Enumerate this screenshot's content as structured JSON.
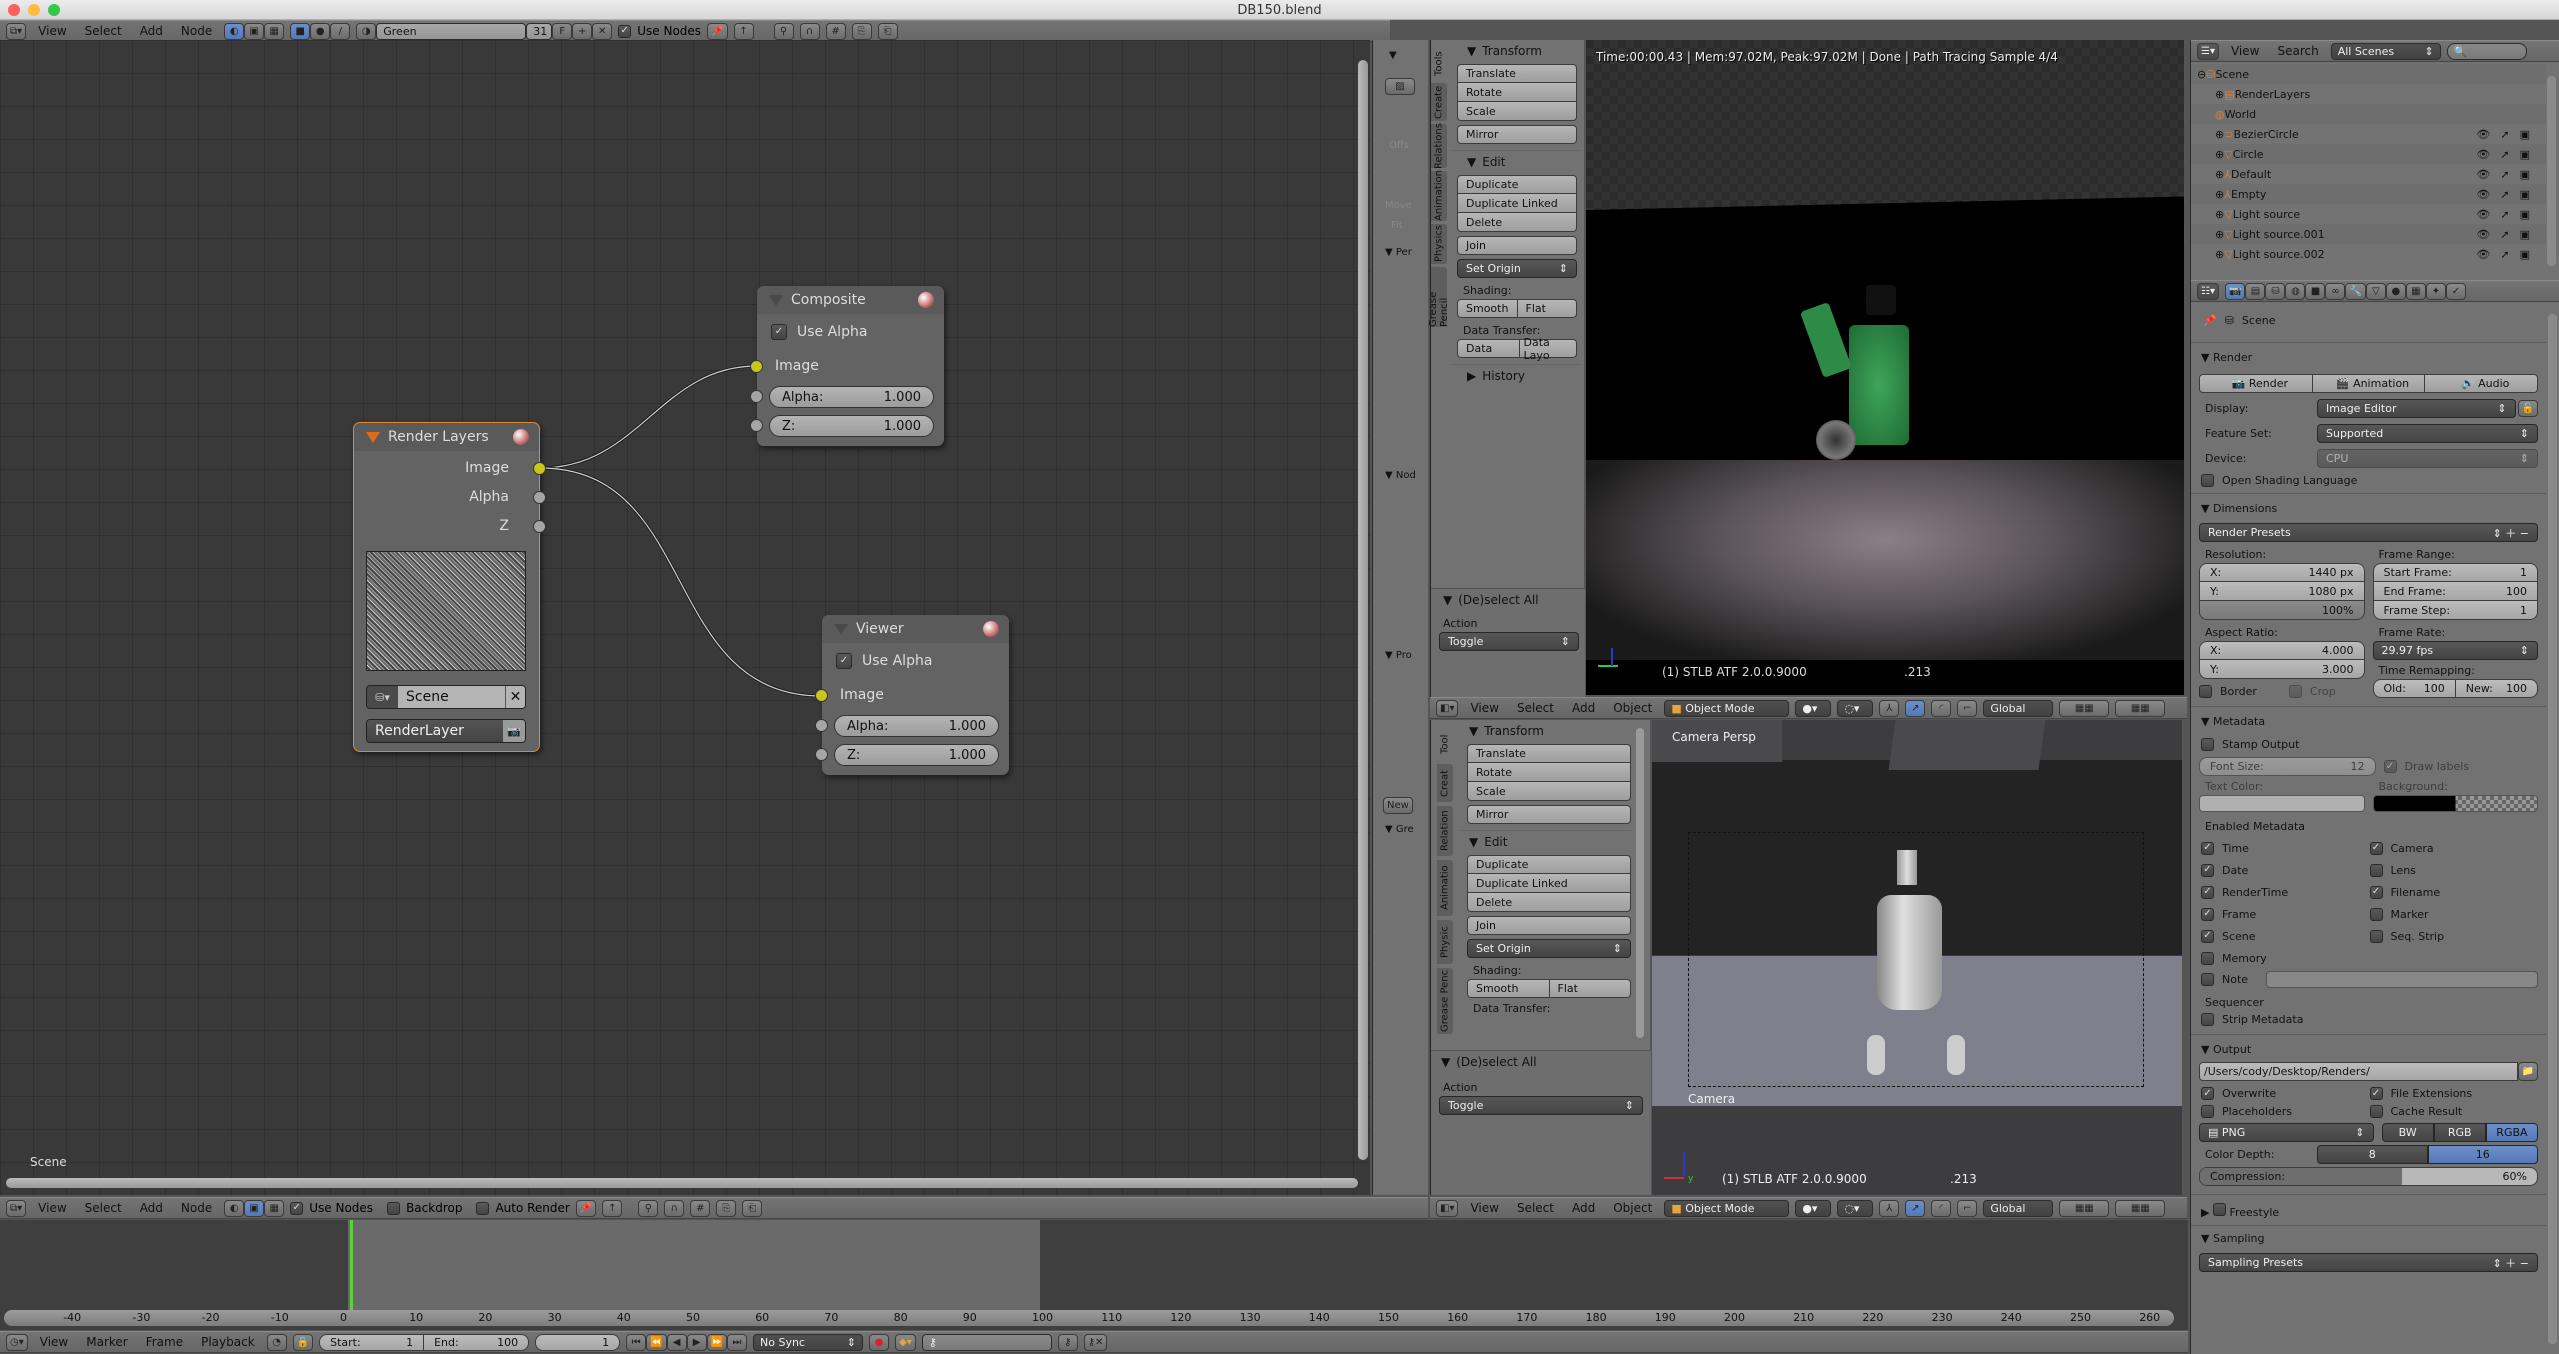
{
  "window": {
    "title": "DB150.blend"
  },
  "node_editor": {
    "header": {
      "menus": [
        "View",
        "Select",
        "Add",
        "Node"
      ],
      "material_name": "Green",
      "users": "31",
      "fake_user": "F",
      "use_nodes_label": "Use Nodes",
      "use_nodes": true
    },
    "bottom_header": {
      "menus": [
        "View",
        "Select",
        "Add",
        "Node"
      ],
      "use_nodes_label": "Use Nodes",
      "backdrop_label": "Backdrop",
      "auto_render_label": "Auto Render"
    },
    "scene_label": "Scene",
    "nodes": {
      "render_layers": {
        "title": "Render Layers",
        "outputs": [
          "Image",
          "Alpha",
          "Z"
        ],
        "scene": "Scene",
        "layer": "RenderLayer"
      },
      "composite": {
        "title": "Composite",
        "use_alpha_label": "Use Alpha",
        "use_alpha": true,
        "input_label": "Image",
        "alpha_label": "Alpha:",
        "alpha_value": "1.000",
        "z_label": "Z:",
        "z_value": "1.000"
      },
      "viewer": {
        "title": "Viewer",
        "use_alpha_label": "Use Alpha",
        "use_alpha": true,
        "input_label": "Image",
        "alpha_label": "Alpha:",
        "alpha_value": "1.000",
        "z_label": "Z:",
        "z_value": "1.000"
      }
    },
    "side_panel": {
      "offs_label": "Offs",
      "move_label": "Move",
      "fit_label": "Fit",
      "per_label": "Per",
      "nod_label": "Nod",
      "pro_label": "Pro",
      "gre_label": "Gre",
      "new_label": "New"
    }
  },
  "tool_shelf_top": {
    "tabs": [
      "Tools",
      "Create",
      "Relations",
      "Animation",
      "Physics",
      "Grease Pencil"
    ],
    "transform_title": "Transform",
    "transform_buttons": [
      "Translate",
      "Rotate",
      "Scale"
    ],
    "mirror": "Mirror",
    "edit_title": "Edit",
    "edit_buttons": [
      "Duplicate",
      "Duplicate Linked",
      "Delete"
    ],
    "join": "Join",
    "set_origin": "Set Origin",
    "shading_label": "Shading:",
    "smooth": "Smooth",
    "flat": "Flat",
    "data_transfer_label": "Data Transfer:",
    "data": "Data",
    "data_layout": "Data Layo",
    "history": "History",
    "deselect_title": "(De)select All",
    "action_label": "Action",
    "action_value": "Toggle"
  },
  "viewport_top": {
    "status": "Time:00:00.43 | Mem:97.02M, Peak:97.02M | Done | Path Tracing Sample 4/4",
    "object_info": "(1) STLB ATF 2.0.0.9000",
    "frame_info": ".213",
    "header": {
      "menus": [
        "View",
        "Select",
        "Add",
        "Object"
      ],
      "mode": "Object Mode",
      "orientation": "Global"
    }
  },
  "tool_shelf_bottom": {
    "tabs": [
      "Tool",
      "Creat",
      "Relation",
      "Animatio",
      "Physic",
      "Grease Penc"
    ],
    "transform_title": "Transform",
    "transform_buttons": [
      "Translate",
      "Rotate",
      "Scale"
    ],
    "mirror": "Mirror",
    "edit_title": "Edit",
    "edit_buttons": [
      "Duplicate",
      "Duplicate Linked",
      "Delete"
    ],
    "join": "Join",
    "set_origin": "Set Origin",
    "shading_label": "Shading:",
    "smooth": "Smooth",
    "flat": "Flat",
    "data_transfer_label": "Data Transfer:",
    "deselect_title": "(De)select All",
    "action_label": "Action",
    "action_value": "Toggle"
  },
  "viewport_bottom": {
    "view_label": "Camera Persp",
    "camera_label": "Camera",
    "object_info": "(1) STLB ATF 2.0.0.9000",
    "frame_info": ".213",
    "header": {
      "menus": [
        "View",
        "Select",
        "Add",
        "Object"
      ],
      "mode": "Object Mode",
      "orientation": "Global"
    }
  },
  "outliner": {
    "menus": [
      "View",
      "Search"
    ],
    "scene_filter": "All Scenes",
    "search_placeholder": "",
    "items": [
      {
        "name": "Scene",
        "depth": 0
      },
      {
        "name": "RenderLayers",
        "depth": 1
      },
      {
        "name": "World",
        "depth": 1
      },
      {
        "name": "BezierCircle",
        "depth": 1
      },
      {
        "name": "Circle",
        "depth": 1
      },
      {
        "name": "Default",
        "depth": 1
      },
      {
        "name": "Empty",
        "depth": 1
      },
      {
        "name": "Light source",
        "depth": 1
      },
      {
        "name": "Light source.001",
        "depth": 1
      },
      {
        "name": "Light source.002",
        "depth": 1
      }
    ]
  },
  "properties": {
    "context": "Scene",
    "render": {
      "title": "Render",
      "buttons": [
        "Render",
        "Animation",
        "Audio"
      ],
      "display_label": "Display:",
      "display_value": "Image Editor",
      "feature_set_label": "Feature Set:",
      "feature_set_value": "Supported",
      "device_label": "Device:",
      "device_value": "CPU",
      "osl_label": "Open Shading Language"
    },
    "dimensions": {
      "title": "Dimensions",
      "presets": "Render Presets",
      "resolution_label": "Resolution:",
      "res_x_label": "X:",
      "res_x": "1440 px",
      "res_y_label": "Y:",
      "res_y": "1080 px",
      "res_pct": "100%",
      "frame_range_label": "Frame Range:",
      "start_label": "Start Frame:",
      "start": "1",
      "end_label": "End Frame:",
      "end": "100",
      "step_label": "Frame Step:",
      "step": "1",
      "aspect_label": "Aspect Ratio:",
      "asp_x_label": "X:",
      "asp_x": "4.000",
      "asp_y_label": "Y:",
      "asp_y": "3.000",
      "frame_rate_label": "Frame Rate:",
      "frame_rate": "29.97 fps",
      "remap_label": "Time Remapping:",
      "old_label": "Old:",
      "old": "100",
      "new_label": "New:",
      "new": "100",
      "border_label": "Border",
      "crop_label": "Crop"
    },
    "metadata": {
      "title": "Metadata",
      "stamp_label": "Stamp Output",
      "font_size_label": "Font Size:",
      "font_size": "12",
      "draw_labels": "Draw labels",
      "text_color_label": "Text Color:",
      "background_label": "Background:",
      "enabled_label": "Enabled Metadata",
      "left": [
        {
          "label": "Time",
          "checked": true
        },
        {
          "label": "Date",
          "checked": true
        },
        {
          "label": "RenderTime",
          "checked": true
        },
        {
          "label": "Frame",
          "checked": true
        },
        {
          "label": "Scene",
          "checked": true
        },
        {
          "label": "Memory",
          "checked": false
        }
      ],
      "right": [
        {
          "label": "Camera",
          "checked": true
        },
        {
          "label": "Lens",
          "checked": false
        },
        {
          "label": "Filename",
          "checked": true
        },
        {
          "label": "Marker",
          "checked": false
        },
        {
          "label": "Seq. Strip",
          "checked": false
        }
      ],
      "note_label": "Note",
      "sequencer_label": "Sequencer",
      "strip_label": "Strip Metadata"
    },
    "output": {
      "title": "Output",
      "path": "/Users/cody/Desktop/Renders/",
      "overwrite": "Overwrite",
      "file_ext": "File Extensions",
      "placeholders": "Placeholders",
      "cache": "Cache Result",
      "format": "PNG",
      "color_modes": [
        "BW",
        "RGB",
        "RGBA"
      ],
      "color_mode_selected": "RGBA",
      "depth_label": "Color Depth:",
      "depths": [
        "8",
        "16"
      ],
      "depth_selected": "16",
      "compression_label": "Compression:",
      "compression": "60%",
      "compression_fraction": 0.6
    },
    "freestyle": {
      "title": "Freestyle"
    },
    "sampling": {
      "title": "Sampling",
      "presets": "Sampling Presets"
    }
  },
  "timeline": {
    "menus": [
      "View",
      "Marker",
      "Frame",
      "Playback"
    ],
    "start_label": "Start:",
    "start": "1",
    "end_label": "End:",
    "end": "100",
    "current": "1",
    "sync": "No Sync",
    "ruler": [
      "-40",
      "-30",
      "-20",
      "-10",
      "0",
      "10",
      "20",
      "30",
      "40",
      "50",
      "60",
      "70",
      "80",
      "90",
      "100",
      "110",
      "120",
      "130",
      "140",
      "150",
      "160",
      "170",
      "180",
      "190",
      "200",
      "210",
      "220",
      "230",
      "240",
      "250",
      "260"
    ]
  }
}
